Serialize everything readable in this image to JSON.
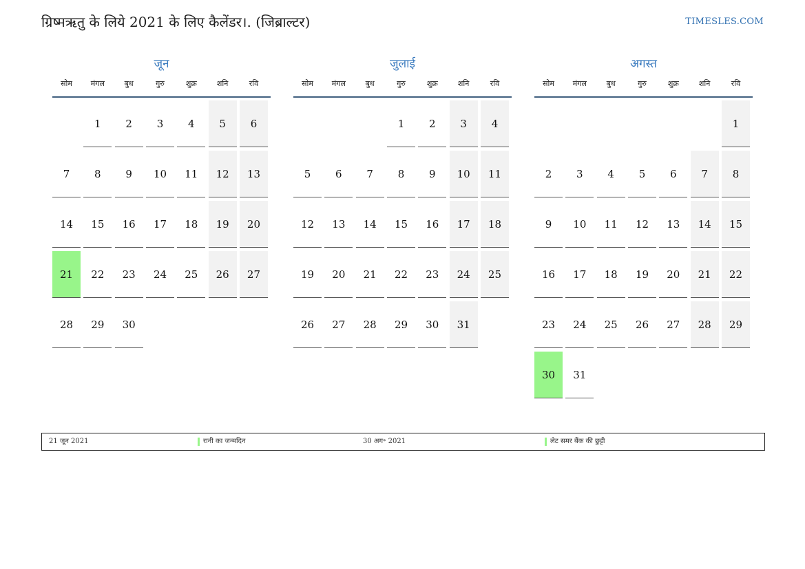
{
  "header": {
    "title": "ग्रिष्मऋतु के लिये 2021 के लिए कैलेंडर।. (जिब्राल्टर)",
    "site": "TIMESLES.COM"
  },
  "colors": {
    "accent": "#3b7bbf",
    "holiday": "#98f58a",
    "weekend": "#f2f2f2",
    "rule": "#41607f"
  },
  "weekdays": [
    "सोम",
    "मंगल",
    "बुध",
    "गुरु",
    "शुक्र",
    "शनि",
    "रवि"
  ],
  "months": [
    {
      "name": "जून",
      "weeks": [
        [
          "",
          "1",
          "2",
          "3",
          "4",
          "5",
          "6"
        ],
        [
          "7",
          "8",
          "9",
          "10",
          "11",
          "12",
          "13"
        ],
        [
          "14",
          "15",
          "16",
          "17",
          "18",
          "19",
          "20"
        ],
        [
          "21",
          "22",
          "23",
          "24",
          "25",
          "26",
          "27"
        ],
        [
          "28",
          "29",
          "30",
          "",
          "",
          "",
          ""
        ]
      ],
      "holidays": [
        "21"
      ]
    },
    {
      "name": "जुलाई",
      "weeks": [
        [
          "",
          "",
          "",
          "1",
          "2",
          "3",
          "4"
        ],
        [
          "5",
          "6",
          "7",
          "8",
          "9",
          "10",
          "11"
        ],
        [
          "12",
          "13",
          "14",
          "15",
          "16",
          "17",
          "18"
        ],
        [
          "19",
          "20",
          "21",
          "22",
          "23",
          "24",
          "25"
        ],
        [
          "26",
          "27",
          "28",
          "29",
          "30",
          "31",
          ""
        ]
      ],
      "holidays": []
    },
    {
      "name": "अगस्त",
      "weeks": [
        [
          "",
          "",
          "",
          "",
          "",
          "",
          "1"
        ],
        [
          "2",
          "3",
          "4",
          "5",
          "6",
          "7",
          "8"
        ],
        [
          "9",
          "10",
          "11",
          "12",
          "13",
          "14",
          "15"
        ],
        [
          "16",
          "17",
          "18",
          "19",
          "20",
          "21",
          "22"
        ],
        [
          "23",
          "24",
          "25",
          "26",
          "27",
          "28",
          "29"
        ],
        [
          "30",
          "31",
          "",
          "",
          "",
          "",
          ""
        ]
      ],
      "holidays": [
        "30"
      ]
    }
  ],
  "legend": [
    {
      "date": "21 जून 2021",
      "label": "रानी का जन्मदिन"
    },
    {
      "date": "30 अग॰ 2021",
      "label": "लेट समर बैंक की छुट्टी"
    }
  ]
}
